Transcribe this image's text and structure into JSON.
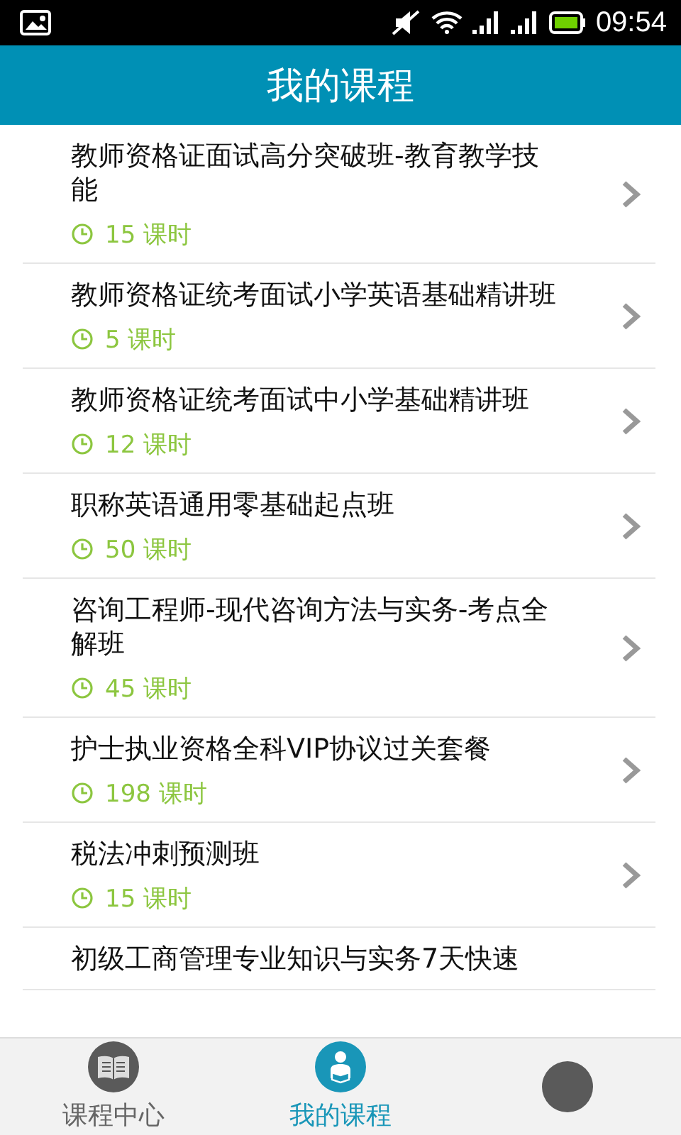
{
  "status_bar": {
    "time": "09:54"
  },
  "header": {
    "title": "我的课程"
  },
  "courses": [
    {
      "title": "教师资格证面试高分突破班-教育教学技能",
      "lessons": "15 课时"
    },
    {
      "title": "教师资格证统考面试小学英语基础精讲班",
      "lessons": "5 课时"
    },
    {
      "title": "教师资格证统考面试中小学基础精讲班",
      "lessons": "12 课时"
    },
    {
      "title": "职称英语通用零基础起点班",
      "lessons": "50 课时"
    },
    {
      "title": "咨询工程师-现代咨询方法与实务-考点全解班",
      "lessons": "45 课时"
    },
    {
      "title": "护士执业资格全科VIP协议过关套餐",
      "lessons": "198 课时"
    },
    {
      "title": "税法冲刺预测班",
      "lessons": "15 课时"
    },
    {
      "title": "初级工商管理专业知识与实务7天快速"
    }
  ],
  "tabs": [
    {
      "kind": "book",
      "label": "课程中心",
      "selected": false
    },
    {
      "kind": "reader",
      "label": "我的课程",
      "selected": true
    },
    {
      "kind": "other",
      "selected": false
    }
  ]
}
